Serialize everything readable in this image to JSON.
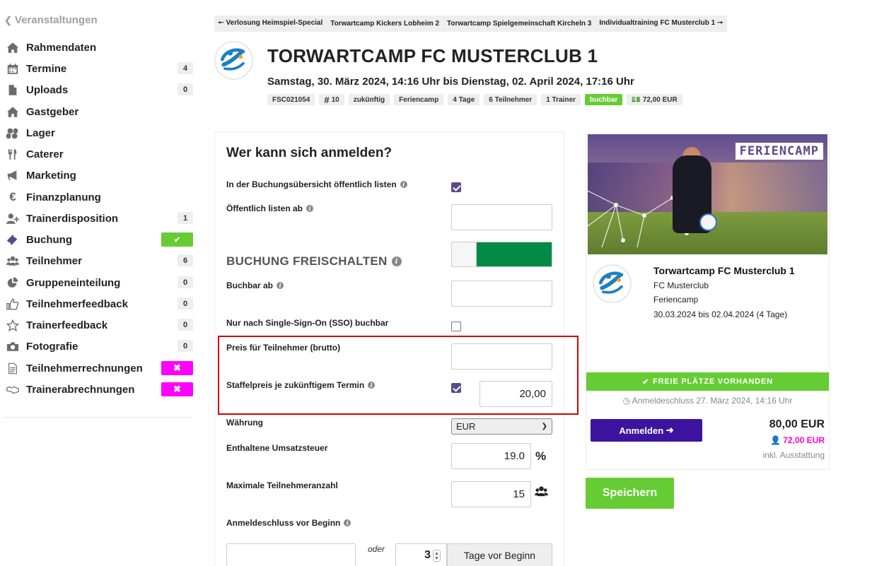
{
  "sidebar": {
    "back_label": "Veranstaltungen",
    "items": [
      {
        "label": "Rahmendaten",
        "icon": "home-icon",
        "badge": ""
      },
      {
        "label": "Termine",
        "icon": "calendar-icon",
        "badge": "4"
      },
      {
        "label": "Uploads",
        "icon": "file-icon",
        "badge": "0"
      },
      {
        "label": "Gastgeber",
        "icon": "home-icon",
        "badge": ""
      },
      {
        "label": "Lager",
        "icon": "cubes-icon",
        "badge": ""
      },
      {
        "label": "Caterer",
        "icon": "cutlery-icon",
        "badge": ""
      },
      {
        "label": "Marketing",
        "icon": "bullhorn-icon",
        "badge": ""
      },
      {
        "label": "Finanzplanung",
        "icon": "euro-icon",
        "badge": ""
      },
      {
        "label": "Trainerdisposition",
        "icon": "user-plus-icon",
        "badge": "1"
      },
      {
        "label": "Buchung",
        "icon": "ticket-icon",
        "badge": "✔"
      },
      {
        "label": "Teilnehmer",
        "icon": "users-icon",
        "badge": "6"
      },
      {
        "label": "Gruppeneinteilung",
        "icon": "pie-chart-icon",
        "badge": "0"
      },
      {
        "label": "Teilnehmerfeedback",
        "icon": "thumbs-up-icon",
        "badge": "0"
      },
      {
        "label": "Trainerfeedback",
        "icon": "star-icon",
        "badge": "0"
      },
      {
        "label": "Fotografie",
        "icon": "camera-icon",
        "badge": "0"
      },
      {
        "label": "Teilnehmerrechnungen",
        "icon": "document-icon",
        "badge": "✖"
      },
      {
        "label": "Trainerabrechnungen",
        "icon": "handshake-icon",
        "badge": "✖"
      }
    ]
  },
  "navbar": {
    "prev": "Verlosung Heimspiel-Special",
    "links": [
      "Torwartcamp Kickers Lobheim 2",
      "Torwartcamp Spielgemeinschaft Kircheln 3"
    ],
    "next": "Individualtraining FC Musterclub 1"
  },
  "event": {
    "title": "TORWARTCAMP FC MUSTERCLUB 1",
    "dates": "Samstag, 30. März 2024, 14:16 Uhr bis Dienstag, 02. April 2024, 17:16 Uhr",
    "tags": [
      "FSC021054",
      "10",
      "zukünftig",
      "Feriencamp",
      "4 Tage",
      "6 Teilnehmer",
      "1 Trainer",
      "buchbar",
      "72,00 EUR"
    ]
  },
  "form": {
    "title": "Wer kann sich anmelden?",
    "public_list_label": "In der Buchungsübersicht öffentlich listen",
    "public_from_label": "Öffentlich listen ab",
    "public_from_value": "",
    "section_title": "BUCHUNG FREISCHALTEN",
    "bookable_from_label": "Buchbar ab",
    "bookable_from_value": "",
    "sso_label": "Nur nach Single-Sign-On (SSO) buchbar",
    "price_label": "Preis für Teilnehmer (brutto)",
    "price_value": "",
    "tier_label": "Staffelpreis je zukünftigem Termin",
    "tier_value": "20,00",
    "currency_label": "Währung",
    "currency_value": "EUR",
    "vat_label": "Enthaltene Umsatzsteuer",
    "vat_value": "19.0",
    "vat_suffix": "%",
    "max_label": "Maximale Teilnehmeranzahl",
    "max_value": "15",
    "deadline_label": "Anmeldeschluss vor Beginn",
    "deadline_date_value": "",
    "or_label": "oder",
    "days_value": "3",
    "days_suffix": "Tage vor Beginn"
  },
  "card": {
    "banner": "FERIENCAMP",
    "title": "Torwartcamp FC Musterclub 1",
    "club": "FC Musterclub",
    "type": "Feriencamp",
    "dates": "30.03.2024 bis 02.04.2024 (4 Tage)",
    "status": "FREIE PLÄTZE VORHANDEN",
    "deadline": "Anmeldeschluss 27. März 2024, 14:16 Uhr",
    "register_label": "Anmelden",
    "price": "80,00 EUR",
    "member_price": "72,00 EUR",
    "price_note": "inkl. Ausstattung"
  },
  "save_label": "Speichern",
  "colors": {
    "accent_green": "#66cc33",
    "toggle_green": "#028a47",
    "purple": "#3c149f",
    "magenta": "#ff00ff",
    "highlight_red": "#d60000"
  }
}
